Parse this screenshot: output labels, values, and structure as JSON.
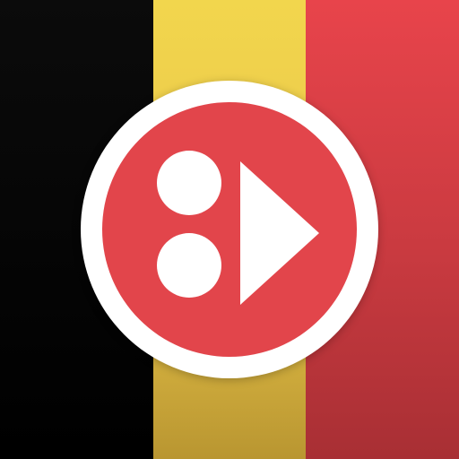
{
  "icon": {
    "flag_colors": {
      "black": "#000000",
      "yellow": "#efd04c",
      "red": "#e2444a"
    },
    "badge_colors": {
      "ring": "#ffffff",
      "fill": "#e2454b",
      "mark": "#ffffff"
    },
    "logo_symbol": "two-dots-play-icon"
  }
}
